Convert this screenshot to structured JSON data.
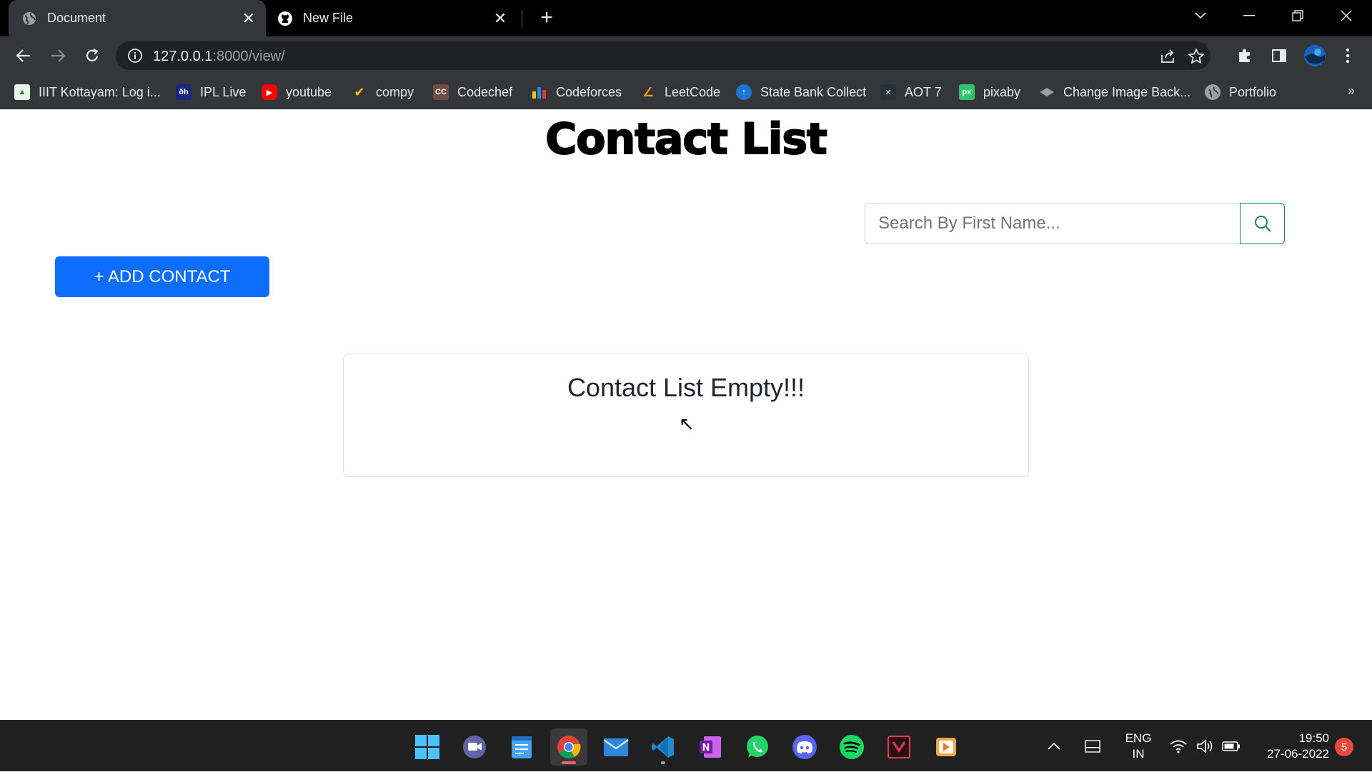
{
  "browser": {
    "tabs": [
      {
        "title": "Document",
        "icon": "globe-icon",
        "active": true
      },
      {
        "title": "New File",
        "icon": "github-icon",
        "active": false
      }
    ],
    "address": {
      "host": "127.0.0.1",
      "rest": ":8000/view/"
    },
    "bookmarks": [
      {
        "label": "IIIT Kottayam: Log i...",
        "icon": "iiit-icon",
        "color": "#2e7d32"
      },
      {
        "label": "IPL Live",
        "icon": "ipl-icon",
        "color": "#1a237e"
      },
      {
        "label": "youtube",
        "icon": "youtube-icon",
        "color": "#ff0000"
      },
      {
        "label": "compy",
        "icon": "compy-icon",
        "color": "#f9c200"
      },
      {
        "label": "Codechef",
        "icon": "codechef-icon",
        "color": "#6d4c41"
      },
      {
        "label": "Codeforces",
        "icon": "codeforces-icon",
        "color": "#1e88e5"
      },
      {
        "label": "LeetCode",
        "icon": "leetcode-icon",
        "color": "#f39c12"
      },
      {
        "label": "State Bank Collect",
        "icon": "sbi-icon",
        "color": "#1976d2"
      },
      {
        "label": "AOT 7",
        "icon": "aot-icon",
        "color": "#263238"
      },
      {
        "label": "pixaby",
        "icon": "pixabay-icon",
        "color": "#2ec66d"
      },
      {
        "label": "Change Image Back...",
        "icon": "layers-icon",
        "color": "#9e9e9e"
      },
      {
        "label": "Portfolio",
        "icon": "globe-icon",
        "color": "#9e9e9e"
      }
    ],
    "bookmarks_more": "»"
  },
  "page": {
    "title": "Contact List",
    "search": {
      "placeholder": "Search By First Name..."
    },
    "add_button": "+ ADD CONTACT",
    "empty_message": "Contact List Empty!!!",
    "colors": {
      "primary": "#0d6efd",
      "success": "#198754"
    }
  },
  "taskbar": {
    "apps": [
      "windows-start-icon",
      "teams-chat-icon",
      "notepad-icon",
      "chrome-icon",
      "mail-icon",
      "vscode-icon",
      "onenote-icon",
      "whatsapp-icon",
      "discord-icon",
      "spotify-icon",
      "app-icon",
      "media-player-icon"
    ],
    "lang_line1": "ENG",
    "lang_line2": "IN",
    "time": "19:50",
    "date": "27-06-2022",
    "notifications": "5"
  }
}
